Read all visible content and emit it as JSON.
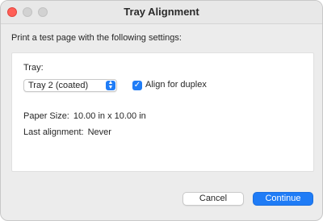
{
  "window": {
    "title": "Tray Alignment"
  },
  "intro_text": "Print a test page with the following settings:",
  "tray": {
    "label": "Tray:",
    "selected": "Tray 2 (coated)",
    "popup_icon": "up-down-chevrons-icon"
  },
  "duplex": {
    "label": "Align for duplex",
    "checked": true,
    "check_icon": "checkmark-icon"
  },
  "paper_size": {
    "label": "Paper Size:",
    "value": "10.00 in x 10.00 in"
  },
  "last_alignment": {
    "label": "Last alignment:",
    "value": "Never"
  },
  "buttons": {
    "cancel": "Cancel",
    "continue": "Continue"
  },
  "colors": {
    "accent": "#1f7cf6",
    "close": "#ff5f57"
  }
}
